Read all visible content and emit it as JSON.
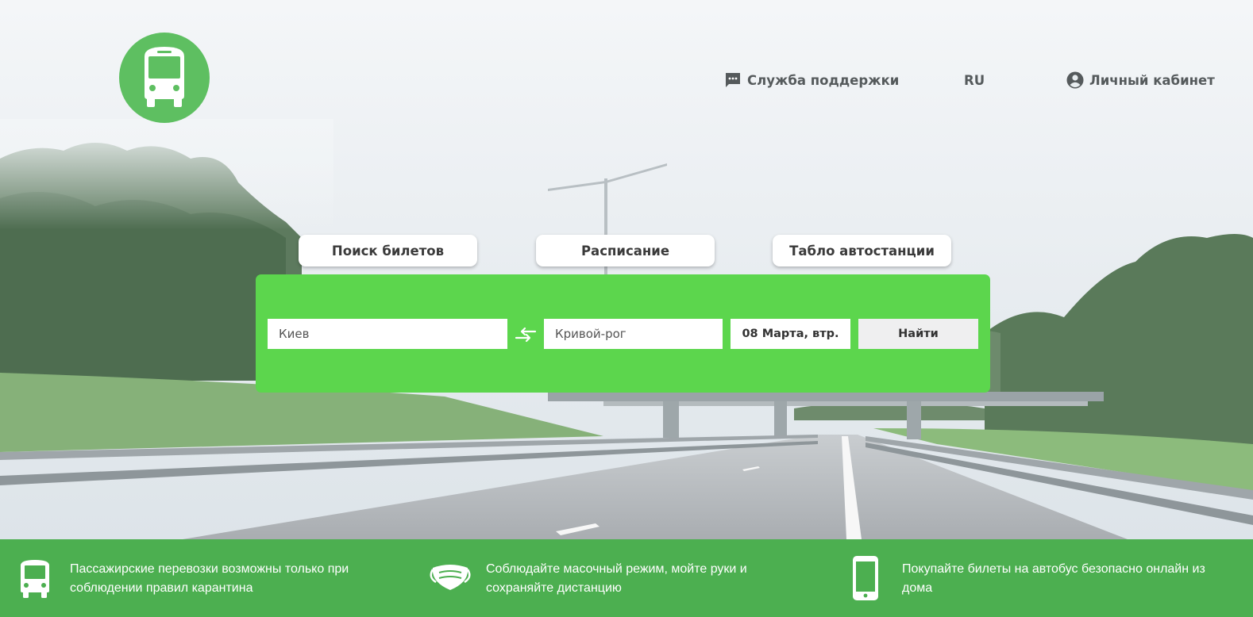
{
  "header": {
    "support_label": "Служба поддержки",
    "language": "RU",
    "account_label": "Личный кабинет"
  },
  "tabs": [
    {
      "label": "Поиск билетов"
    },
    {
      "label": "Расписание"
    },
    {
      "label": "Табло автостанции"
    }
  ],
  "search": {
    "from_value": "Киев",
    "to_value": "Кривой-рог",
    "date": "08 Марта, втр.",
    "submit_label": "Найти"
  },
  "footer": {
    "items": [
      {
        "icon": "bus-icon",
        "text": "Пассажирские перевозки возможны только при соблюдении правил карантина"
      },
      {
        "icon": "face-mask-icon",
        "text": "Соблюдайте масочный режим, мойте руки и сохраняйте дистанцию"
      },
      {
        "icon": "smartphone-icon",
        "text": "Покупайте билеты на автобус безопасно онлайн из дома"
      }
    ]
  },
  "colors": {
    "panel": "#5cd64d",
    "footer": "#4caf50",
    "logo": "#5ebf61"
  }
}
